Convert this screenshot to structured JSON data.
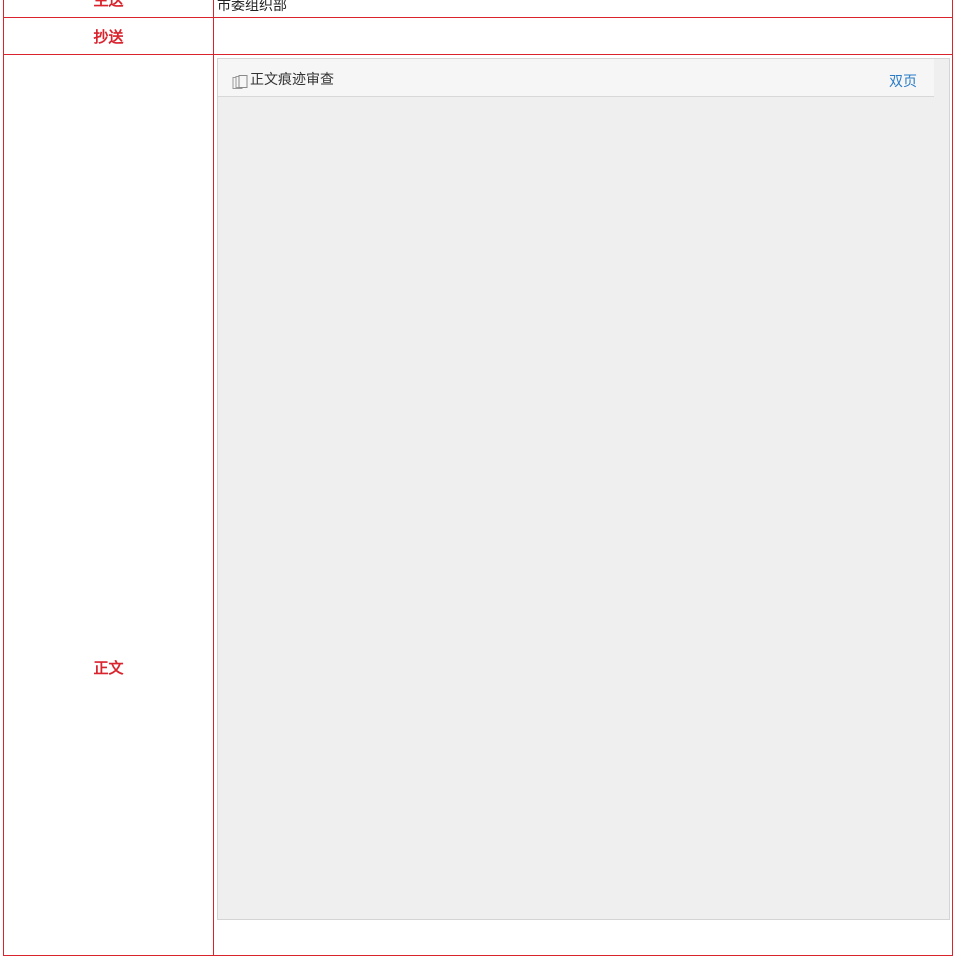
{
  "rows": {
    "zhusong": {
      "label": "主送",
      "value": "市委组织部"
    },
    "chaosong": {
      "label": "抄送",
      "value": ""
    },
    "zhengwen": {
      "label": "正文"
    }
  },
  "doc_viewer": {
    "toolbar_icon": "document-pages-icon",
    "title": "正文痕迹审查",
    "double_page_label": "双页"
  },
  "colors": {
    "border": "#d9232d",
    "label_text": "#d9232d",
    "link": "#2a7cc7",
    "viewer_bg": "#efefef"
  }
}
